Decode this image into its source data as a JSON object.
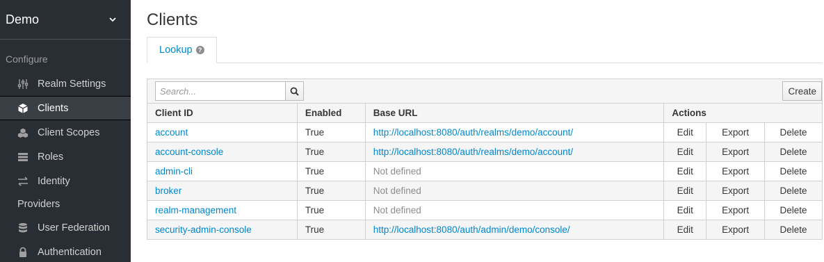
{
  "sidebar": {
    "realm": "Demo",
    "section": "Configure",
    "items": [
      {
        "label": "Realm Settings",
        "icon": "sliders-icon"
      },
      {
        "label": "Clients",
        "icon": "cube-icon",
        "active": true
      },
      {
        "label": "Client Scopes",
        "icon": "cubes-icon"
      },
      {
        "label": "Roles",
        "icon": "list-icon"
      },
      {
        "label": "Identity",
        "icon": "exchange-icon"
      },
      {
        "label": "Providers",
        "icon": ""
      },
      {
        "label": "User Federation",
        "icon": "database-icon"
      },
      {
        "label": "Authentication",
        "icon": "lock-icon"
      }
    ]
  },
  "page": {
    "title": "Clients",
    "tab": "Lookup"
  },
  "toolbar": {
    "search_placeholder": "Search...",
    "create_label": "Create"
  },
  "table": {
    "headers": [
      "Client ID",
      "Enabled",
      "Base URL",
      "Actions"
    ],
    "action_labels": {
      "edit": "Edit",
      "export": "Export",
      "delete": "Delete"
    },
    "rows": [
      {
        "client_id": "account",
        "enabled": "True",
        "base_url": "http://localhost:8080/auth/realms/demo/account/",
        "defined": true
      },
      {
        "client_id": "account-console",
        "enabled": "True",
        "base_url": "http://localhost:8080/auth/realms/demo/account/",
        "defined": true
      },
      {
        "client_id": "admin-cli",
        "enabled": "True",
        "base_url": "Not defined",
        "defined": false
      },
      {
        "client_id": "broker",
        "enabled": "True",
        "base_url": "Not defined",
        "defined": false
      },
      {
        "client_id": "realm-management",
        "enabled": "True",
        "base_url": "Not defined",
        "defined": false
      },
      {
        "client_id": "security-admin-console",
        "enabled": "True",
        "base_url": "http://localhost:8080/auth/admin/demo/console/",
        "defined": true
      }
    ]
  },
  "colors": {
    "sidebar_bg": "#292e34",
    "link": "#0088ce",
    "muted": "#8b8d8f"
  }
}
